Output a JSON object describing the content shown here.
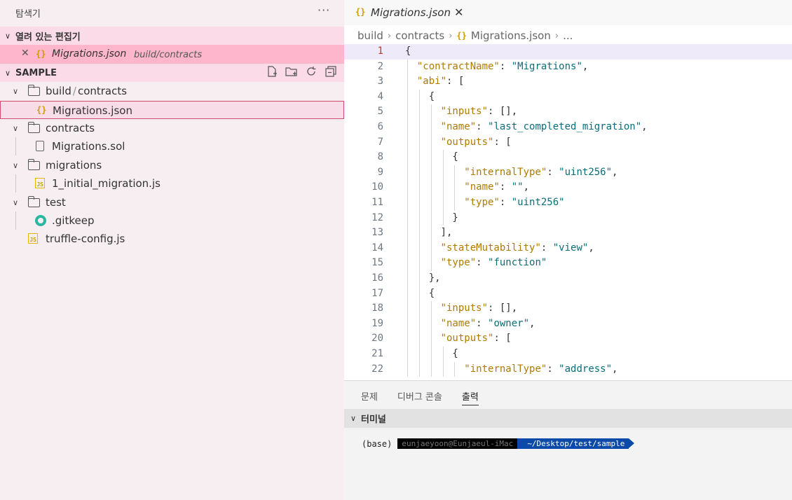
{
  "sidebar": {
    "title": "탐색기",
    "more": "···",
    "open_editors": {
      "header": "열려 있는 편집기",
      "items": [
        {
          "name": "Migrations.json",
          "path": "build/contracts"
        }
      ]
    },
    "workspace": {
      "header": "SAMPLE",
      "tools": [
        "new-file-icon",
        "new-folder-icon",
        "refresh-icon",
        "collapse-all-icon"
      ],
      "tree": [
        {
          "label": "build",
          "label2": "contracts",
          "type": "folder"
        },
        {
          "label": "Migrations.json",
          "type": "json",
          "selected": true
        },
        {
          "label": "contracts",
          "type": "folder"
        },
        {
          "label": "Migrations.sol",
          "type": "file"
        },
        {
          "label": "migrations",
          "type": "folder"
        },
        {
          "label": "1_initial_migration.js",
          "type": "js"
        },
        {
          "label": "test",
          "type": "folder"
        },
        {
          "label": ".gitkeep",
          "type": "git"
        },
        {
          "label": "truffle-config.js",
          "type": "js"
        }
      ]
    }
  },
  "editor": {
    "tab": {
      "name": "Migrations.json",
      "icon": "{}"
    },
    "breadcrumb": [
      "build",
      "contracts",
      "Migrations.json",
      "..."
    ],
    "lines": [
      {
        "n": "1",
        "t": "{"
      },
      {
        "n": "2",
        "t": "  \"contractName\": \"Migrations\","
      },
      {
        "n": "3",
        "t": "  \"abi\": ["
      },
      {
        "n": "4",
        "t": "    {"
      },
      {
        "n": "5",
        "t": "      \"inputs\": [],"
      },
      {
        "n": "6",
        "t": "      \"name\": \"last_completed_migration\","
      },
      {
        "n": "7",
        "t": "      \"outputs\": ["
      },
      {
        "n": "8",
        "t": "        {"
      },
      {
        "n": "9",
        "t": "          \"internalType\": \"uint256\","
      },
      {
        "n": "10",
        "t": "          \"name\": \"\","
      },
      {
        "n": "11",
        "t": "          \"type\": \"uint256\""
      },
      {
        "n": "12",
        "t": "        }"
      },
      {
        "n": "13",
        "t": "      ],"
      },
      {
        "n": "14",
        "t": "      \"stateMutability\": \"view\","
      },
      {
        "n": "15",
        "t": "      \"type\": \"function\""
      },
      {
        "n": "16",
        "t": "    },"
      },
      {
        "n": "17",
        "t": "    {"
      },
      {
        "n": "18",
        "t": "      \"inputs\": [],"
      },
      {
        "n": "19",
        "t": "      \"name\": \"owner\","
      },
      {
        "n": "20",
        "t": "      \"outputs\": ["
      },
      {
        "n": "21",
        "t": "        {"
      },
      {
        "n": "22",
        "t": "          \"internalType\": \"address\","
      }
    ]
  },
  "panel": {
    "tabs": [
      "문제",
      "디버그 콘솔",
      "출력"
    ],
    "active_tab": "출력",
    "terminal_header": "터미널",
    "prompt": {
      "env": "(base)",
      "user": "eunjaeyoon@Eunjaeul-iMac",
      "dir": "~/Desktop/test/sample"
    }
  },
  "colors": {
    "key": "#b07a00",
    "string": "#0a6d7a",
    "selection_border": "#d04d72",
    "open_editor_bg": "#fdb6cc"
  }
}
